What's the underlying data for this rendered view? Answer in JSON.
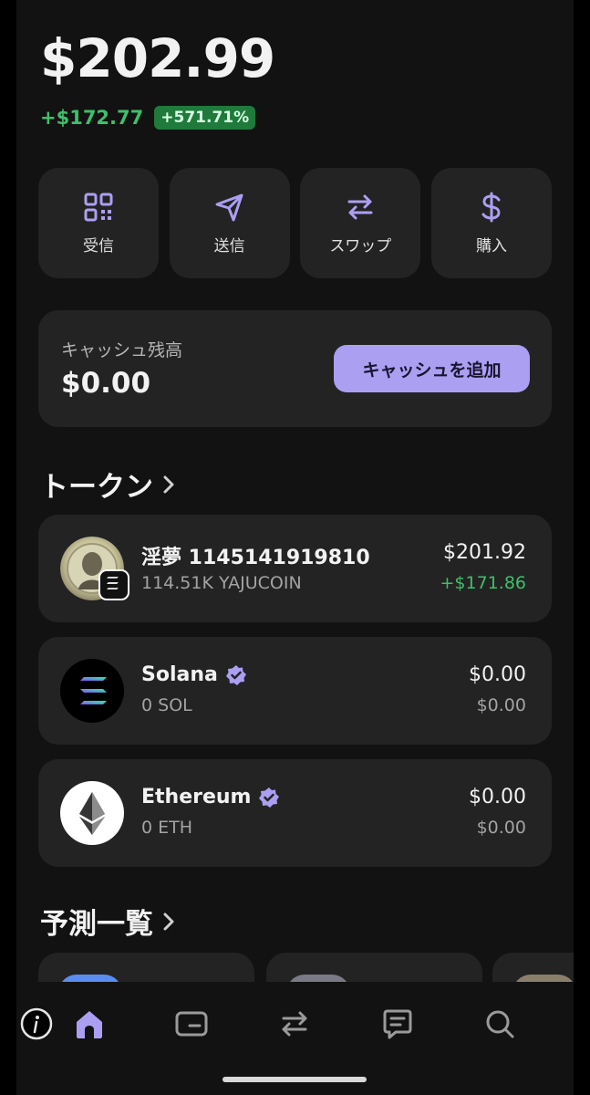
{
  "wallet": {
    "balance": "$202.99",
    "change_amount": "+$172.77",
    "change_percent": "+571.71%"
  },
  "actions": [
    {
      "label": "受信",
      "icon": "qr-code-icon"
    },
    {
      "label": "送信",
      "icon": "send-icon"
    },
    {
      "label": "スワップ",
      "icon": "swap-icon"
    },
    {
      "label": "購入",
      "icon": "dollar-icon"
    }
  ],
  "cash": {
    "title": "キャッシュ残高",
    "amount": "$0.00",
    "button_label": "キャッシュを追加"
  },
  "tokens_section": {
    "title": "トークン"
  },
  "tokens": [
    {
      "name": "淫夢 1145141919810",
      "sub": "114.51K YAJUCOIN",
      "value": "$201.92",
      "change": "+$171.86",
      "verified": false
    },
    {
      "name": "Solana",
      "sub": "0 SOL",
      "value": "$0.00",
      "change": "$0.00",
      "verified": true
    },
    {
      "name": "Ethereum",
      "sub": "0 ETH",
      "value": "$0.00",
      "change": "$0.00",
      "verified": true
    }
  ],
  "predictions_section": {
    "title": "予測一覧"
  },
  "nav": [
    {
      "name": "home",
      "icon": "home-icon",
      "active": true
    },
    {
      "name": "wallet",
      "icon": "card-icon",
      "active": false
    },
    {
      "name": "swap",
      "icon": "swap-icon",
      "active": false
    },
    {
      "name": "messages",
      "icon": "chat-icon",
      "active": false
    },
    {
      "name": "search",
      "icon": "search-icon",
      "active": false
    }
  ],
  "colors": {
    "accent": "#ab9ff2",
    "positive": "#3fbf6a",
    "card": "#232323",
    "background": "#121212"
  }
}
